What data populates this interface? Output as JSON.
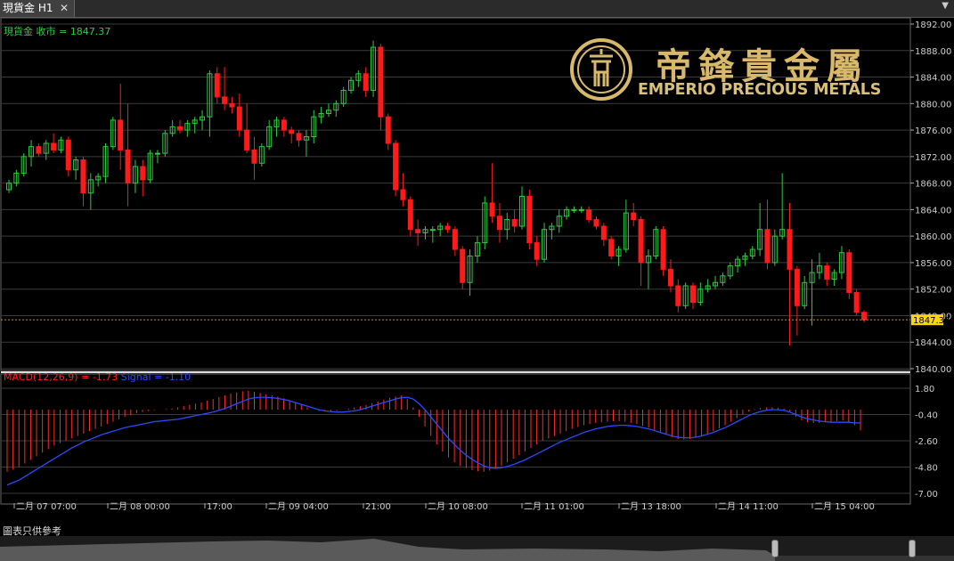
{
  "window": {
    "tab_title": "現貨金 H1",
    "close_glyph": "✕",
    "menu_glyph": "▼"
  },
  "main": {
    "label": "現貨金 收市 = 1847.37",
    "last_price": "1847.37",
    "y_ticks": [
      "1892.00",
      "1888.00",
      "1884.00",
      "1880.00",
      "1876.00",
      "1872.00",
      "1868.00",
      "1864.00",
      "1860.00",
      "1856.00",
      "1852.00",
      "1848.00",
      "1844.00",
      "1840.00"
    ]
  },
  "macd": {
    "label_macd": "MACD(12,26,9) = -1.73",
    "label_signal": "Signal = -1.10",
    "y_ticks": [
      "1.80",
      "-0.40",
      "-2.60",
      "-4.80",
      "-7.00"
    ]
  },
  "x_ticks": [
    "二月 07 07:00",
    "二月 08 00:00",
    "17:00",
    "二月 09 04:00",
    "21:00",
    "二月 10 08:00",
    "二月 11 01:00",
    "二月 13 18:00",
    "二月 14 11:00",
    "二月 15 04:00"
  ],
  "footer_note": "圖表只供參考",
  "logo": {
    "en": "EMPERIO PRECIOUS METALS",
    "cn": "帝鋒貴金屬"
  },
  "colors": {
    "bull": "#2ecc40",
    "bear": "#ff1a1a",
    "grid": "#3a3a3a",
    "label_green": "#2ecc40",
    "label_red": "#ff2020",
    "label_blue": "#2a4bff",
    "gold": "#d8b86a",
    "last_price_bg": "#ffd700"
  },
  "chart_data": [
    {
      "type": "candlestick",
      "title": "現貨金 H1",
      "ylim": [
        1840,
        1892
      ],
      "x": [
        "二月 07 07:00",
        "二月 08 00:00",
        "17:00",
        "二月 09 04:00",
        "21:00",
        "二月 10 08:00",
        "二月 11 01:00",
        "二月 13 18:00",
        "二月 14 11:00",
        "二月 15 04:00"
      ],
      "last_close": 1847.37,
      "ohlc": [
        [
          1867.0,
          1868.5,
          1866.5,
          1868.0
        ],
        [
          1868.0,
          1870.0,
          1867.5,
          1869.5
        ],
        [
          1869.5,
          1872.5,
          1869.0,
          1872.0
        ],
        [
          1872.0,
          1874.5,
          1870.5,
          1873.5
        ],
        [
          1873.5,
          1874.0,
          1872.0,
          1872.5
        ],
        [
          1872.5,
          1874.5,
          1871.5,
          1874.0
        ],
        [
          1874.0,
          1875.5,
          1872.5,
          1873.0
        ],
        [
          1873.0,
          1875.0,
          1872.5,
          1874.5
        ],
        [
          1874.5,
          1875.0,
          1869.0,
          1870.0
        ],
        [
          1870.0,
          1872.0,
          1868.5,
          1871.5
        ],
        [
          1871.5,
          1872.0,
          1864.5,
          1866.5
        ],
        [
          1866.5,
          1869.5,
          1864.0,
          1868.5
        ],
        [
          1868.5,
          1869.5,
          1867.5,
          1869.0
        ],
        [
          1869.0,
          1874.0,
          1868.0,
          1873.5
        ],
        [
          1873.5,
          1878.0,
          1873.0,
          1877.5
        ],
        [
          1877.5,
          1883.0,
          1870.0,
          1873.0
        ],
        [
          1873.0,
          1880.0,
          1864.5,
          1868.0
        ],
        [
          1868.0,
          1871.5,
          1866.5,
          1870.5
        ],
        [
          1870.5,
          1871.5,
          1866.0,
          1868.5
        ],
        [
          1868.5,
          1873.0,
          1868.0,
          1872.5
        ],
        [
          1872.5,
          1873.0,
          1871.0,
          1872.5
        ],
        [
          1872.5,
          1876.0,
          1872.0,
          1875.5
        ],
        [
          1875.5,
          1877.5,
          1875.0,
          1876.5
        ],
        [
          1876.5,
          1877.5,
          1875.5,
          1876.0
        ],
        [
          1876.0,
          1877.5,
          1875.0,
          1877.0
        ],
        [
          1877.0,
          1878.0,
          1875.5,
          1877.5
        ],
        [
          1877.5,
          1879.0,
          1876.0,
          1878.0
        ],
        [
          1878.0,
          1885.0,
          1875.0,
          1884.5
        ],
        [
          1884.5,
          1885.5,
          1880.0,
          1881.0
        ],
        [
          1881.0,
          1885.5,
          1879.0,
          1880.0
        ],
        [
          1880.0,
          1881.0,
          1878.5,
          1879.5
        ],
        [
          1879.5,
          1881.5,
          1875.0,
          1876.0
        ],
        [
          1876.0,
          1880.0,
          1872.5,
          1873.0
        ],
        [
          1873.0,
          1875.0,
          1868.5,
          1871.0
        ],
        [
          1871.0,
          1874.0,
          1870.5,
          1873.5
        ],
        [
          1873.5,
          1877.5,
          1873.0,
          1876.5
        ],
        [
          1876.5,
          1878.0,
          1875.0,
          1877.5
        ],
        [
          1877.5,
          1878.0,
          1875.0,
          1876.0
        ],
        [
          1876.0,
          1876.5,
          1874.0,
          1875.5
        ],
        [
          1875.5,
          1876.0,
          1873.5,
          1874.5
        ],
        [
          1874.5,
          1876.0,
          1872.0,
          1875.0
        ],
        [
          1875.0,
          1879.0,
          1874.0,
          1878.0
        ],
        [
          1878.0,
          1879.5,
          1877.0,
          1878.5
        ],
        [
          1878.5,
          1880.0,
          1878.0,
          1879.0
        ],
        [
          1879.0,
          1880.5,
          1878.0,
          1880.0
        ],
        [
          1880.0,
          1882.5,
          1879.5,
          1882.0
        ],
        [
          1882.0,
          1884.0,
          1881.5,
          1883.5
        ],
        [
          1883.5,
          1885.0,
          1882.5,
          1884.5
        ],
        [
          1884.5,
          1885.5,
          1881.0,
          1882.0
        ],
        [
          1882.0,
          1889.5,
          1881.0,
          1888.5
        ],
        [
          1888.5,
          1889.0,
          1876.0,
          1878.0
        ],
        [
          1878.0,
          1878.5,
          1873.0,
          1874.0
        ],
        [
          1874.0,
          1874.5,
          1866.0,
          1867.0
        ],
        [
          1867.0,
          1869.5,
          1864.5,
          1865.5
        ],
        [
          1865.5,
          1866.0,
          1860.0,
          1861.0
        ],
        [
          1861.0,
          1862.5,
          1858.5,
          1860.5
        ],
        [
          1860.5,
          1861.5,
          1859.5,
          1861.0
        ],
        [
          1861.0,
          1861.5,
          1859.0,
          1861.0
        ],
        [
          1861.0,
          1862.0,
          1860.0,
          1861.5
        ],
        [
          1861.5,
          1862.0,
          1860.5,
          1861.0
        ],
        [
          1861.0,
          1861.5,
          1857.0,
          1858.0
        ],
        [
          1858.0,
          1858.5,
          1852.0,
          1853.0
        ],
        [
          1853.0,
          1858.0,
          1851.0,
          1857.0
        ],
        [
          1857.0,
          1860.0,
          1856.0,
          1859.0
        ],
        [
          1859.0,
          1866.0,
          1858.0,
          1865.0
        ],
        [
          1865.0,
          1871.0,
          1862.0,
          1863.0
        ],
        [
          1863.0,
          1865.0,
          1859.0,
          1861.0
        ],
        [
          1861.0,
          1863.5,
          1859.5,
          1862.5
        ],
        [
          1862.5,
          1864.0,
          1860.5,
          1861.5
        ],
        [
          1861.5,
          1867.5,
          1861.0,
          1866.0
        ],
        [
          1866.0,
          1867.0,
          1858.0,
          1859.0
        ],
        [
          1859.0,
          1860.0,
          1855.5,
          1856.5
        ],
        [
          1856.5,
          1862.0,
          1856.0,
          1861.0
        ],
        [
          1861.0,
          1862.0,
          1859.5,
          1861.5
        ],
        [
          1861.5,
          1864.0,
          1860.5,
          1863.0
        ],
        [
          1863.0,
          1864.5,
          1862.5,
          1864.0
        ],
        [
          1864.0,
          1864.5,
          1863.5,
          1864.0
        ],
        [
          1864.0,
          1864.5,
          1863.5,
          1864.0
        ],
        [
          1864.0,
          1864.5,
          1862.0,
          1862.5
        ],
        [
          1862.5,
          1863.0,
          1861.0,
          1861.5
        ],
        [
          1861.5,
          1862.0,
          1858.5,
          1859.5
        ],
        [
          1859.5,
          1860.0,
          1856.5,
          1857.0
        ],
        [
          1857.0,
          1858.5,
          1855.5,
          1858.0
        ],
        [
          1858.0,
          1865.5,
          1857.5,
          1863.5
        ],
        [
          1863.5,
          1865.0,
          1861.5,
          1862.5
        ],
        [
          1862.5,
          1863.0,
          1852.5,
          1856.0
        ],
        [
          1856.0,
          1858.0,
          1852.0,
          1857.0
        ],
        [
          1857.0,
          1861.5,
          1856.5,
          1861.0
        ],
        [
          1861.0,
          1861.5,
          1854.0,
          1855.0
        ],
        [
          1855.0,
          1856.5,
          1851.5,
          1852.5
        ],
        [
          1852.5,
          1853.5,
          1848.5,
          1849.5
        ],
        [
          1849.5,
          1853.0,
          1849.0,
          1852.5
        ],
        [
          1852.5,
          1853.0,
          1849.0,
          1850.0
        ],
        [
          1850.0,
          1853.0,
          1849.5,
          1852.0
        ],
        [
          1852.0,
          1853.5,
          1851.5,
          1852.5
        ],
        [
          1852.5,
          1854.0,
          1852.0,
          1853.0
        ],
        [
          1853.0,
          1854.5,
          1852.5,
          1854.0
        ],
        [
          1854.0,
          1856.0,
          1853.5,
          1855.5
        ],
        [
          1855.5,
          1857.0,
          1854.5,
          1856.5
        ],
        [
          1856.5,
          1857.5,
          1855.5,
          1857.0
        ],
        [
          1857.0,
          1858.5,
          1856.5,
          1858.0
        ],
        [
          1858.0,
          1865.0,
          1857.0,
          1861.0
        ],
        [
          1861.0,
          1865.5,
          1855.0,
          1856.0
        ],
        [
          1856.0,
          1861.0,
          1855.5,
          1860.0
        ],
        [
          1860.0,
          1869.5,
          1859.5,
          1861.0
        ],
        [
          1861.0,
          1865.0,
          1843.5,
          1855.0
        ],
        [
          1855.0,
          1855.5,
          1845.0,
          1849.5
        ],
        [
          1849.5,
          1854.0,
          1849.0,
          1853.0
        ],
        [
          1853.0,
          1856.5,
          1846.5,
          1854.5
        ],
        [
          1854.5,
          1857.5,
          1853.5,
          1855.5
        ],
        [
          1855.5,
          1856.0,
          1852.5,
          1853.5
        ],
        [
          1853.5,
          1855.0,
          1852.5,
          1854.5
        ],
        [
          1854.5,
          1858.5,
          1853.5,
          1857.5
        ],
        [
          1857.5,
          1858.0,
          1850.5,
          1851.5
        ],
        [
          1851.5,
          1852.0,
          1848.0,
          1848.5
        ],
        [
          1848.5,
          1848.8,
          1847.0,
          1847.37
        ]
      ]
    },
    {
      "type": "bar+line",
      "title": "MACD(12,26,9)",
      "ylim": [
        -7.0,
        1.8
      ],
      "macd_last": -1.73,
      "signal_last": -1.1,
      "macd": [
        -5.2,
        -5.0,
        -4.8,
        -4.5,
        -4.2,
        -3.9,
        -3.6,
        -3.3,
        -3.0,
        -2.8,
        -2.6,
        -2.4,
        -2.2,
        -2.0,
        -1.8,
        -1.6,
        -1.4,
        -1.2,
        -1.0,
        -0.8,
        -0.6,
        -0.45,
        -0.3,
        -0.2,
        -0.1,
        -0.05,
        0.0,
        0.05,
        0.1,
        0.2,
        0.3,
        0.4,
        0.5,
        0.6,
        0.75,
        0.9,
        1.05,
        1.2,
        1.35,
        1.45,
        1.55,
        1.6,
        1.5,
        1.4,
        1.3,
        1.2,
        1.1,
        0.95,
        0.8,
        0.6,
        0.4,
        0.2,
        0.0,
        -0.1,
        -0.15,
        -0.2,
        -0.1,
        0.0,
        0.1,
        0.2,
        0.3,
        0.4,
        0.55,
        0.7,
        0.85,
        1.0,
        1.1,
        1.2,
        0.9,
        0.2,
        -0.6,
        -1.4,
        -2.2,
        -2.9,
        -3.5,
        -4.0,
        -4.4,
        -4.7,
        -4.9,
        -5.05,
        -5.15,
        -5.2,
        -5.1,
        -4.9,
        -4.7,
        -4.4,
        -4.1,
        -3.8,
        -3.5,
        -3.2,
        -2.9,
        -2.6,
        -2.4,
        -2.2,
        -2.0,
        -1.8,
        -1.6,
        -1.45,
        -1.3,
        -1.2,
        -1.1,
        -1.05,
        -1.0,
        -0.95,
        -0.95,
        -1.0,
        -1.1,
        -1.2,
        -1.35,
        -1.5,
        -1.7,
        -1.9,
        -2.1,
        -2.3,
        -2.45,
        -2.5,
        -2.45,
        -2.35,
        -2.2,
        -2.0,
        -1.8,
        -1.55,
        -1.3,
        -1.0,
        -0.7,
        -0.4,
        -0.15,
        0.05,
        0.15,
        0.2,
        0.2,
        0.15,
        0.1,
        -0.2,
        -0.6,
        -0.9,
        -1.05,
        -1.1,
        -1.1,
        -1.05,
        -1.0,
        -0.95,
        -0.9,
        -1.0,
        -1.3,
        -1.73
      ],
      "signal": [
        -6.3,
        -6.1,
        -5.9,
        -5.6,
        -5.3,
        -5.0,
        -4.7,
        -4.4,
        -4.1,
        -3.8,
        -3.5,
        -3.2,
        -2.95,
        -2.7,
        -2.5,
        -2.3,
        -2.1,
        -1.95,
        -1.8,
        -1.65,
        -1.5,
        -1.4,
        -1.3,
        -1.2,
        -1.1,
        -1.0,
        -0.95,
        -0.9,
        -0.85,
        -0.8,
        -0.7,
        -0.6,
        -0.5,
        -0.4,
        -0.3,
        -0.2,
        -0.05,
        0.1,
        0.3,
        0.5,
        0.7,
        0.9,
        1.0,
        1.05,
        1.05,
        1.0,
        0.95,
        0.85,
        0.75,
        0.6,
        0.45,
        0.3,
        0.15,
        0.0,
        -0.1,
        -0.15,
        -0.2,
        -0.2,
        -0.15,
        -0.1,
        0.0,
        0.15,
        0.3,
        0.45,
        0.6,
        0.75,
        0.9,
        1.0,
        1.05,
        0.9,
        0.5,
        0.0,
        -0.6,
        -1.2,
        -1.8,
        -2.4,
        -2.9,
        -3.4,
        -3.8,
        -4.15,
        -4.45,
        -4.7,
        -4.85,
        -4.9,
        -4.85,
        -4.75,
        -4.6,
        -4.4,
        -4.2,
        -3.95,
        -3.7,
        -3.45,
        -3.2,
        -2.95,
        -2.7,
        -2.5,
        -2.3,
        -2.1,
        -1.9,
        -1.75,
        -1.6,
        -1.5,
        -1.4,
        -1.35,
        -1.3,
        -1.3,
        -1.35,
        -1.4,
        -1.5,
        -1.6,
        -1.75,
        -1.9,
        -2.05,
        -2.2,
        -2.3,
        -2.35,
        -2.35,
        -2.3,
        -2.2,
        -2.05,
        -1.9,
        -1.7,
        -1.5,
        -1.25,
        -1.0,
        -0.75,
        -0.5,
        -0.3,
        -0.15,
        -0.05,
        0.0,
        0.0,
        -0.05,
        -0.2,
        -0.4,
        -0.6,
        -0.75,
        -0.85,
        -0.95,
        -1.0,
        -1.05,
        -1.05,
        -1.05,
        -1.05,
        -1.1,
        -1.1
      ]
    }
  ]
}
